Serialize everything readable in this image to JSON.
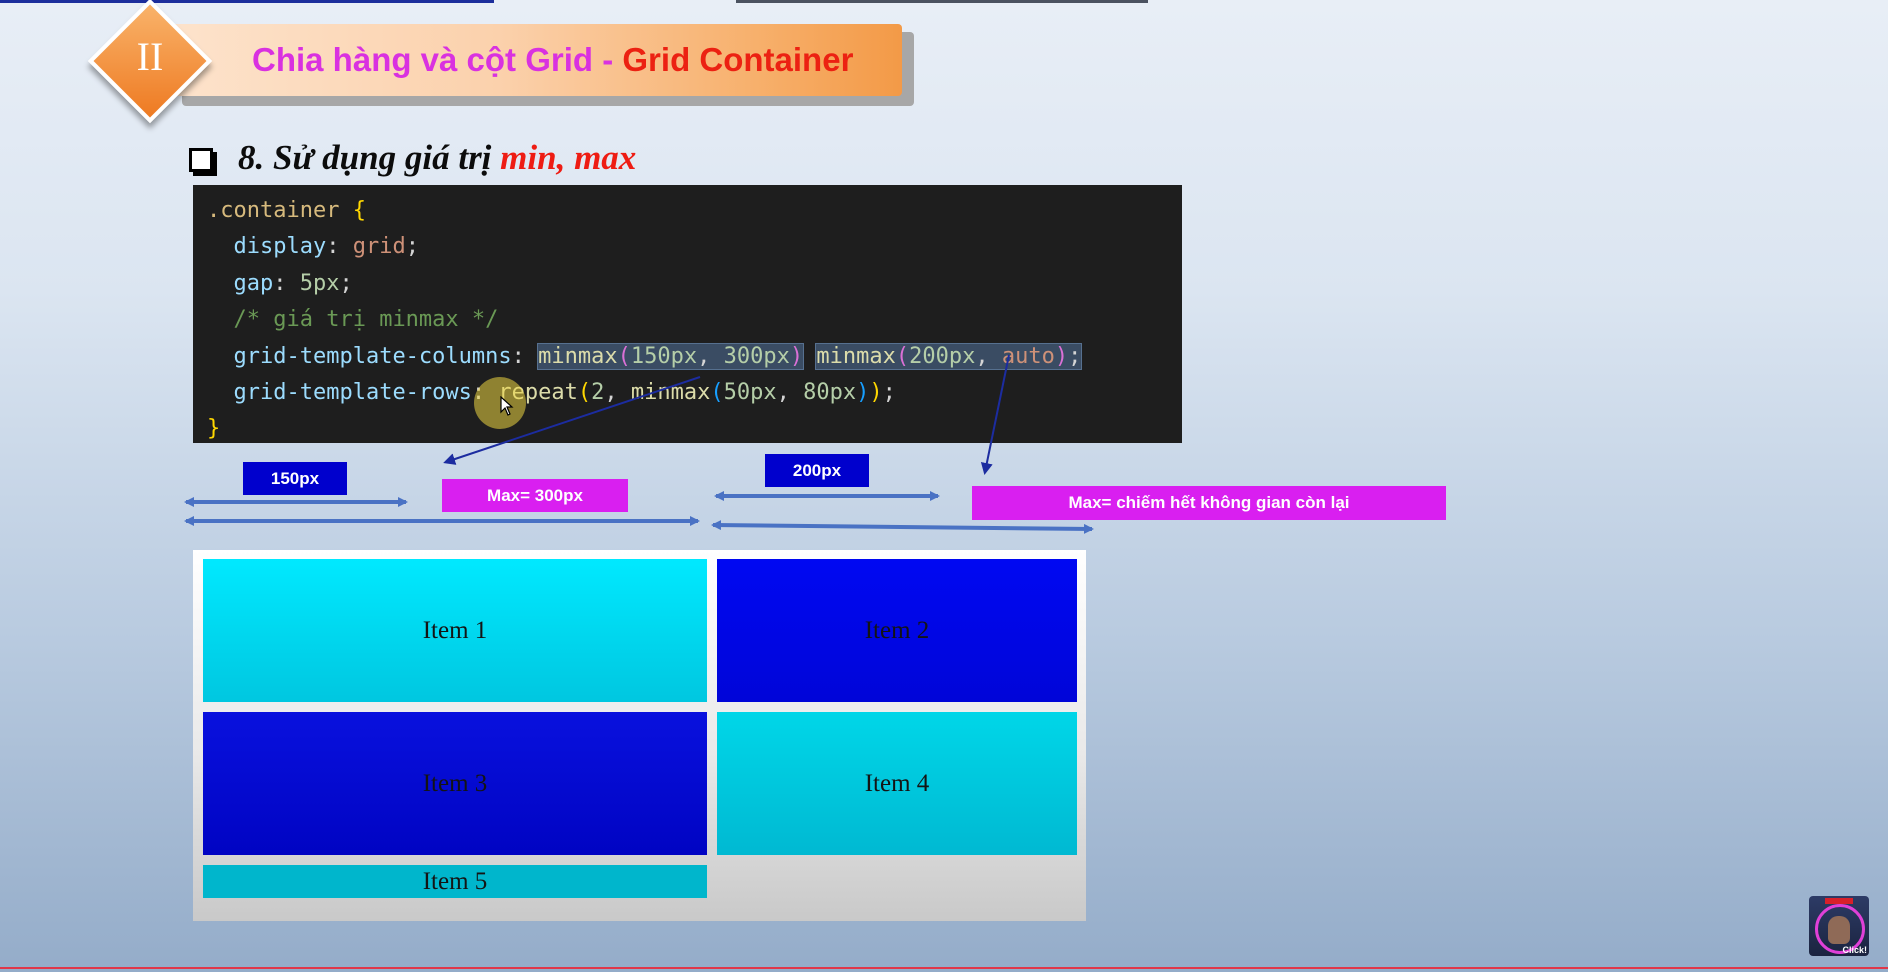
{
  "slide": {
    "section_numeral": "II",
    "title_part1": "Chia hàng và cột Grid - ",
    "title_part2": "Grid Container",
    "heading_part1": "8. Sử dụng giá trị ",
    "heading_part2": "min, max"
  },
  "code": {
    "selector": ".container",
    "open_brace": " {",
    "close_brace": "}",
    "display_prop": "display",
    "display_value": "grid",
    "gap_prop": "gap",
    "gap_value": "5px",
    "comment": "/* giá trị minmax */",
    "columns_prop": "grid-template-columns",
    "columns_fn1": "minmax",
    "columns_fn1_args_a": "150px",
    "columns_fn1_args_b": "300px",
    "columns_fn2": "minmax",
    "columns_fn2_args_a": "200px",
    "columns_fn2_args_b": "auto",
    "rows_prop": "grid-template-rows",
    "rows_fn": "repeat",
    "rows_count": "2",
    "rows_inner_fn": "minmax",
    "rows_args_a": "50px",
    "rows_args_b": "80px"
  },
  "annotations": {
    "col1_min": "150px",
    "col1_max": "Max= 300px",
    "col2_min": "200px",
    "col2_max": "Max=  chiếm hết không gian còn lại"
  },
  "grid_items": [
    "Item 1",
    "Item 2",
    "Item 3",
    "Item 4",
    "Item 5"
  ],
  "badge": {
    "text": "Click!"
  },
  "colors": {
    "title_pink": "#d931e0",
    "title_red": "#ec2112",
    "label_blue": "#0000cd",
    "label_pink": "#d91ff0",
    "arrow_blue": "#4a72c4",
    "item_cyan": "#00e9ff",
    "item_blue": "#0008f2"
  }
}
